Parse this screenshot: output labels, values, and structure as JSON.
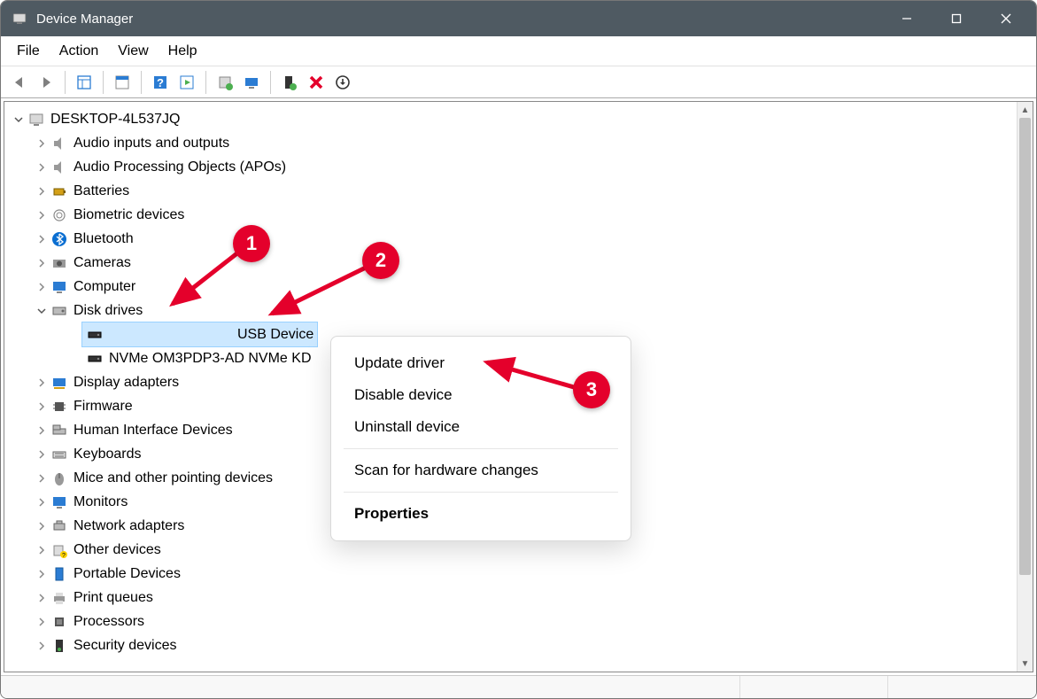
{
  "window": {
    "title": "Device Manager"
  },
  "menu": {
    "file": "File",
    "action": "Action",
    "view": "View",
    "help": "Help"
  },
  "root": {
    "name": "DESKTOP-4L537JQ"
  },
  "nodes": {
    "audio_io": "Audio inputs and outputs",
    "apo": "Audio Processing Objects (APOs)",
    "batteries": "Batteries",
    "biometric": "Biometric devices",
    "bluetooth": "Bluetooth",
    "cameras": "Cameras",
    "computer": "Computer",
    "disk_drives": "Disk drives",
    "usb_device": "USB Device",
    "nvme": "NVMe OM3PDP3-AD NVMe KD",
    "display": "Display adapters",
    "firmware": "Firmware",
    "hid": "Human Interface Devices",
    "keyboards": "Keyboards",
    "mice": "Mice and other pointing devices",
    "monitors": "Monitors",
    "network": "Network adapters",
    "other": "Other devices",
    "portable": "Portable Devices",
    "printq": "Print queues",
    "processors": "Processors",
    "security": "Security devices"
  },
  "context": {
    "update": "Update driver",
    "disable": "Disable device",
    "uninstall": "Uninstall device",
    "scan": "Scan for hardware changes",
    "properties": "Properties"
  },
  "badges": {
    "b1": "1",
    "b2": "2",
    "b3": "3"
  }
}
